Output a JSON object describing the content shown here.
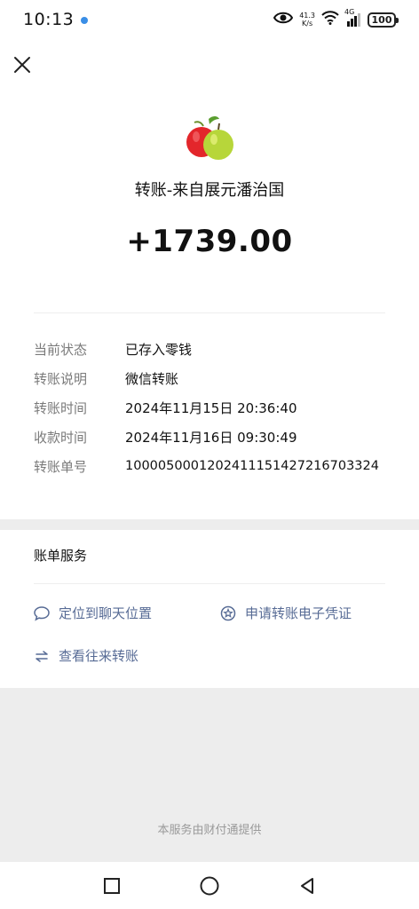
{
  "status_bar": {
    "time": "10:13",
    "speed_value": "41.3",
    "speed_unit": "K/s",
    "network": "4G",
    "battery": "100",
    "icons": [
      "eye-icon",
      "wifi-icon",
      "signal-icon",
      "battery-icon"
    ]
  },
  "header": {
    "close_icon": "close-icon"
  },
  "payment": {
    "title": "转账-来自展元潘治国",
    "amount": "+1739.00"
  },
  "details": [
    {
      "label": "当前状态",
      "value": "已存入零钱"
    },
    {
      "label": "转账说明",
      "value": "微信转账"
    },
    {
      "label": "转账时间",
      "value": "2024年11月15日 20:36:40"
    },
    {
      "label": "收款时间",
      "value": "2024年11月16日 09:30:49"
    },
    {
      "label": "转账单号",
      "value": "1000050001202411151427216703324"
    }
  ],
  "services": {
    "title": "账单服务",
    "links": [
      {
        "label": "定位到聊天位置",
        "icon": "chat-bubble-icon"
      },
      {
        "label": "申请转账电子凭证",
        "icon": "badge-star-icon"
      },
      {
        "label": "查看往来转账",
        "icon": "swap-arrows-icon"
      }
    ]
  },
  "footer": {
    "note": "本服务由财付通提供"
  },
  "nav": {
    "icons": [
      "recent-apps-icon",
      "home-icon",
      "back-icon"
    ]
  },
  "colors": {
    "link": "#576b95",
    "label": "#7a7a7a",
    "background_gray": "#ededed"
  }
}
